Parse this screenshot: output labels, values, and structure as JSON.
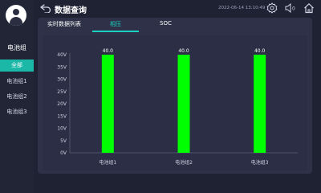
{
  "header": {
    "title": "数据查询",
    "timestamp": "2022-06-14 13:10:49"
  },
  "sidebar": {
    "title": "电池组",
    "items": [
      {
        "label": "全部",
        "active": true
      },
      {
        "label": "电池组1",
        "active": false
      },
      {
        "label": "电池组2",
        "active": false
      },
      {
        "label": "电池组3",
        "active": false
      }
    ]
  },
  "tabs": [
    {
      "label": "实时数据列表",
      "active": false
    },
    {
      "label": "相压",
      "active": true
    },
    {
      "label": "SOC",
      "active": false
    }
  ],
  "colors": {
    "accent": "#1bd1c0",
    "bar": "#00ff00",
    "background": "#1f2233",
    "panel": "#2e3147"
  },
  "icons": {
    "back": "back-arrow-icon",
    "settings": "gear-icon",
    "volume": "speaker-mute-icon",
    "home": "home-icon"
  },
  "chart_data": {
    "type": "bar",
    "categories": [
      "电池组1",
      "电池组2",
      "电池组3"
    ],
    "values": [
      40.0,
      40.0,
      40.0
    ],
    "data_labels": [
      "40.0",
      "40.0",
      "40.0"
    ],
    "y_ticks": [
      "0V",
      "5V",
      "10V",
      "15V",
      "20V",
      "25V",
      "30V",
      "35V",
      "40V"
    ],
    "ylim": [
      0,
      40
    ],
    "grid": false,
    "legend": "none"
  }
}
